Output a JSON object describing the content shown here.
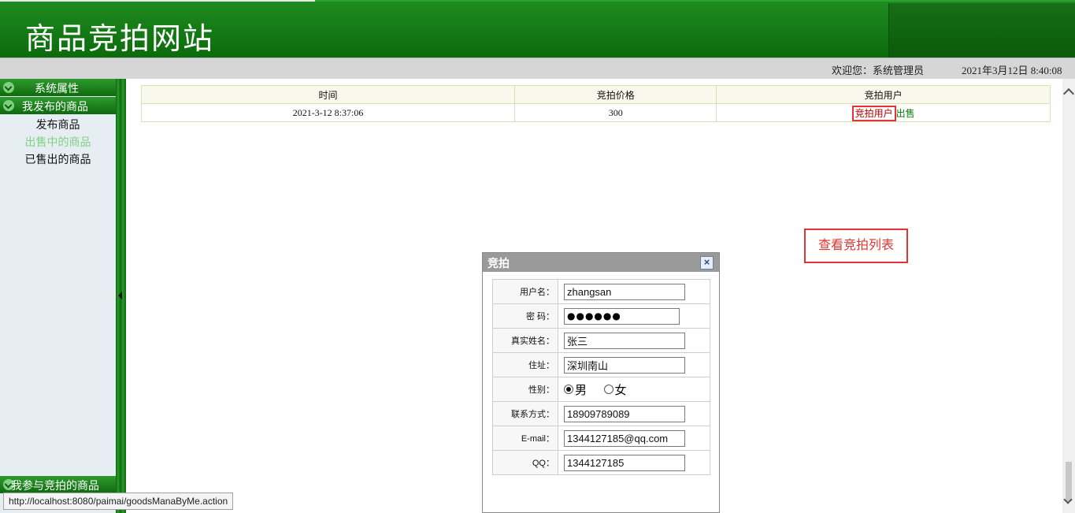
{
  "header": {
    "title": "商品竞拍网站",
    "welcome": "欢迎您：系统管理员",
    "datetime": "2021年3月12日 8:40:08"
  },
  "sidebar": {
    "sections": [
      {
        "label": "系统属性"
      },
      {
        "label": "我发布的商品"
      },
      {
        "label": "我参与竞拍的商品"
      }
    ],
    "items": [
      {
        "label": "发布商品"
      },
      {
        "label": "出售中的商品"
      },
      {
        "label": "已售出的商品"
      }
    ]
  },
  "bid_table": {
    "columns": [
      "时间",
      "竞拍价格",
      "竞拍用户"
    ],
    "rows": [
      {
        "time": "2021-3-12 8:37:06",
        "price": "300",
        "user_link": "竞拍用户",
        "sell_link": "出售"
      }
    ]
  },
  "annotation": "查看竞拍列表",
  "dialog": {
    "title": "竞拍",
    "close_icon": "×",
    "fields": [
      {
        "label": "用户名：",
        "value": "zhangsan"
      },
      {
        "label": "密 码：",
        "value": "●●●●●●"
      },
      {
        "label": "真实姓名：",
        "value": "张三"
      },
      {
        "label": "住址：",
        "value": "深圳南山"
      },
      {
        "label": "性别：",
        "options": [
          "男",
          "女"
        ],
        "selected": "男"
      },
      {
        "label": "联系方式：",
        "value": "18909789089"
      },
      {
        "label": "E-mail：",
        "value": "1344127185@qq.com"
      },
      {
        "label": "QQ：",
        "value": "1344127185"
      }
    ]
  },
  "status_url": "http://localhost:8080/paimai/goodsManaByMe.action",
  "colors": {
    "brand_green": "#0c6b0c",
    "accent_red": "#e23434"
  }
}
